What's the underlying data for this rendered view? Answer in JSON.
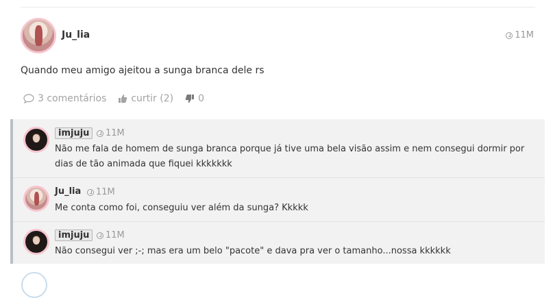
{
  "post": {
    "author": "Ju_lia",
    "time": "11M",
    "text": "Quando meu amigo ajeitou a sunga branca dele rs",
    "actions": {
      "comments": "3 comentários",
      "like": "curtir (2)",
      "dislike": "0"
    }
  },
  "replies": [
    {
      "author": "imjuju",
      "time": "11M",
      "text": "Não me fala de homem de sunga branca porque já tive uma bela visão assim e nem consegui dormir por dias de tão animada que fiquei kkkkkkk"
    },
    {
      "author": "Ju_lia",
      "time": "11M",
      "text": "Me conta como foi, conseguiu ver além da sunga? Kkkkk"
    },
    {
      "author": "imjuju",
      "time": "11M",
      "text": "Não consegui ver ;-; mas era um belo \"pacote\" e dava pra ver o tamanho...nossa kkkkkk"
    }
  ],
  "icons": {
    "comment": "comment-bubble-icon",
    "like": "thumbs-up-icon",
    "dislike": "thumbs-down-icon",
    "time": "clock-icon"
  },
  "colors": {
    "avatar_border": "#f7c5cf",
    "muted_text": "#9a9a9a",
    "reply_background": "#f2f2f2",
    "reply_accent_bar": "#b9bfc7"
  }
}
